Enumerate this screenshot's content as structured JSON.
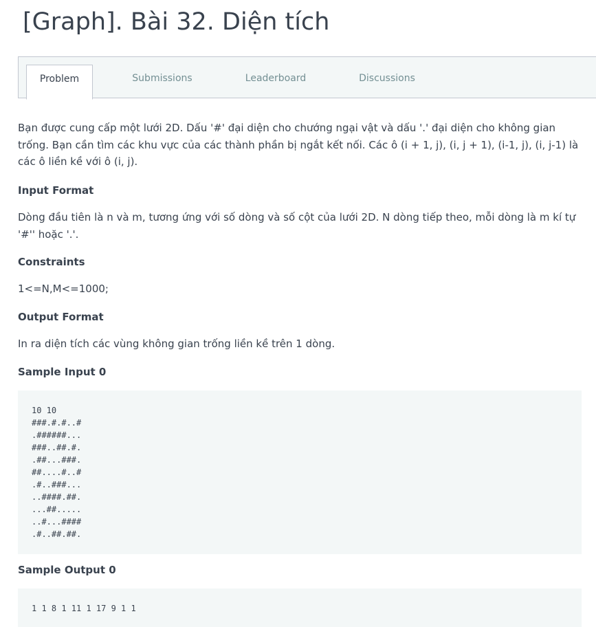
{
  "problem": {
    "title": "[Graph]. Bài 32. Diện tích"
  },
  "tabs": [
    {
      "label": "Problem",
      "active": true
    },
    {
      "label": "Submissions",
      "active": false
    },
    {
      "label": "Leaderboard",
      "active": false
    },
    {
      "label": "Discussions",
      "active": false
    }
  ],
  "statement": {
    "description": "Bạn được cung cấp một lưới 2D. Dấu '#' đại diện cho chướng ngại vật và dấu '.' đại diện cho không gian trống. Bạn cần tìm các khu vực của các thành phần bị ngắt kết nối. Các ô (i + 1, j), (i, j + 1), (i-1, j), (i, j-1) là các ô liền kề với ô (i, j).",
    "input_format_heading": "Input Format",
    "input_format": "Dòng đầu tiên là n và m, tương ứng với số dòng và số cột của lưới 2D. N dòng tiếp theo, mỗi dòng là m kí tự '#'' hoặc '.'.",
    "constraints_heading": "Constraints",
    "constraints": "1<=N,M<=1000;",
    "output_format_heading": "Output Format",
    "output_format": "In ra diện tích các vùng không gian trống liền kề trên 1 dòng.",
    "sample_input_heading": "Sample Input 0",
    "sample_input": "10 10\n###.#.#..#\n.######...\n###..##.#.\n.##...###.\n##....#..#\n.#..###...\n..####.##.\n...##.....\n..#...####\n.#..##.##.",
    "sample_output_heading": "Sample Output 0",
    "sample_output": "1 1 8 1 11 1 17 9 1 1"
  }
}
